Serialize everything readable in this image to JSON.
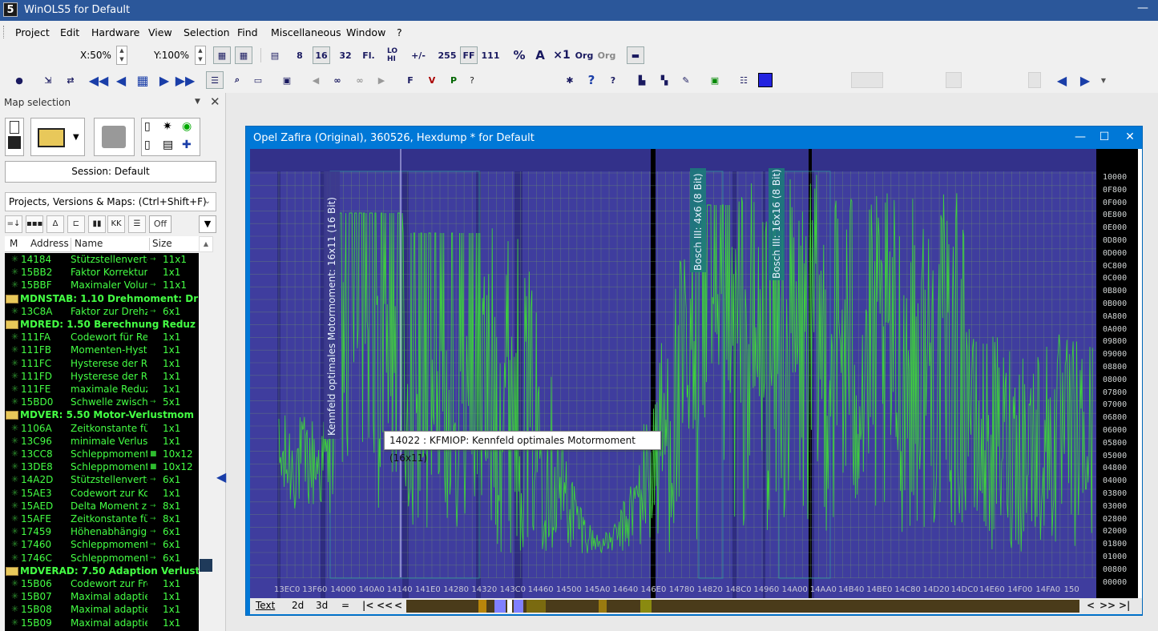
{
  "window": {
    "title": "WinOLS5 for Default",
    "app_icon": "5",
    "minimize": "—"
  },
  "menu": [
    "Project",
    "Edit",
    "Hardware",
    "View",
    "Selection",
    "Find",
    "Miscellaneous",
    "Window",
    "?"
  ],
  "toolbar1": {
    "x_zoom": "X:50%",
    "y_zoom": "Y:100%",
    "buttons": [
      "8",
      "16",
      "32",
      "Fl.",
      "LO HI",
      "+/-",
      "255",
      "FF",
      "111",
      "%",
      "A",
      "×1",
      "Org",
      "Org"
    ]
  },
  "toolbar2": {
    "help": "?"
  },
  "left_panel": {
    "title": "Map selection",
    "session": "Session: Default",
    "projects_combo": "Projects, Versions & Maps:  (Ctrl+Shift+F)",
    "off_button": "Off",
    "columns": [
      "M",
      "Address",
      "Name",
      "Size"
    ],
    "rows": [
      {
        "type": "map",
        "addr": "14184",
        "name": "Stützstellenvertei",
        "mark": "→",
        "size": "11x1"
      },
      {
        "type": "map",
        "addr": "15BB2",
        "name": "Faktor Korrektur",
        "mark": "",
        "size": "1x1"
      },
      {
        "type": "map",
        "addr": "15BBF",
        "name": "Maximaler Volume",
        "mark": "→",
        "size": "11x1"
      },
      {
        "type": "folder",
        "text": "MDNSTAB: 1.10     Drehmoment: Dr"
      },
      {
        "type": "map",
        "addr": "13C8A",
        "name": "Faktor zur Drehza",
        "mark": "→",
        "size": "6x1"
      },
      {
        "type": "folder",
        "text": "MDRED: 1.50     Berechnung Reduz"
      },
      {
        "type": "map",
        "addr": "111FA",
        "name": "Codewort für Rec",
        "mark": "",
        "size": "1x1"
      },
      {
        "type": "map",
        "addr": "111FB",
        "name": "Momenten-Hyste",
        "mark": "",
        "size": "1x1"
      },
      {
        "type": "map",
        "addr": "111FC",
        "name": "Hysterese der Re",
        "mark": "",
        "size": "1x1"
      },
      {
        "type": "map",
        "addr": "111FD",
        "name": "Hysterese der Re",
        "mark": "",
        "size": "1x1"
      },
      {
        "type": "map",
        "addr": "111FE",
        "name": "maximale Reduzie",
        "mark": "",
        "size": "1x1"
      },
      {
        "type": "map",
        "addr": "15BD0",
        "name": "Schwelle zwischer",
        "mark": "→",
        "size": "5x1"
      },
      {
        "type": "folder",
        "text": "MDVER: 5.50     Motor-Verlustmom"
      },
      {
        "type": "map",
        "addr": "1106A",
        "name": "Zeitkonstante für",
        "mark": "",
        "size": "1x1"
      },
      {
        "type": "map",
        "addr": "13C96",
        "name": "minimale Verlustn",
        "mark": "",
        "size": "1x1"
      },
      {
        "type": "map",
        "addr": "13CC8",
        "name": "Schleppmoment",
        "mark": "■",
        "size": "10x12"
      },
      {
        "type": "map",
        "addr": "13DE8",
        "name": "Schleppmoment",
        "mark": "■",
        "size": "10x12"
      },
      {
        "type": "map",
        "addr": "14A2D",
        "name": "Stützstellenvertei",
        "mark": "→",
        "size": "6x1"
      },
      {
        "type": "map",
        "addr": "15AE3",
        "name": "Codewort zur Kor",
        "mark": "",
        "size": "1x1"
      },
      {
        "type": "map",
        "addr": "15AED",
        "name": "Delta Moment zur",
        "mark": "→",
        "size": "8x1"
      },
      {
        "type": "map",
        "addr": "15AFE",
        "name": "Zeitkonstante für",
        "mark": "→",
        "size": "8x1"
      },
      {
        "type": "map",
        "addr": "17459",
        "name": "Höhenabhängige",
        "mark": "→",
        "size": "6x1"
      },
      {
        "type": "map",
        "addr": "17460",
        "name": "Schleppmoment",
        "mark": "→",
        "size": "6x1"
      },
      {
        "type": "map",
        "addr": "1746C",
        "name": "Schleppmoment",
        "mark": "→",
        "size": "6x1"
      },
      {
        "type": "folder",
        "text": "MDVERAD: 7.50     Adaption Verlust"
      },
      {
        "type": "map",
        "addr": "15B06",
        "name": "Codewort zur Frei",
        "mark": "",
        "size": "1x1"
      },
      {
        "type": "map",
        "addr": "15B07",
        "name": "Maximal adaptierl",
        "mark": "",
        "size": "1x1"
      },
      {
        "type": "map",
        "addr": "15B08",
        "name": "Maximal adaptierl",
        "mark": "",
        "size": "1x1"
      },
      {
        "type": "map",
        "addr": "15B09",
        "name": "Maximal adaptierl",
        "mark": "",
        "size": "1x1"
      }
    ]
  },
  "hexdump": {
    "title": "Opel Zafira (Original), 360526, Hexdump * for Default",
    "map_labels": [
      "Kennfeld optimales Motormoment: 16x11 (16 Bit)",
      "Bosch III: 4x6 (8 Bit)",
      "Bosch III: 16x16 (8 Bit)"
    ],
    "x_labels": [
      "13EC0",
      "13F60",
      "14000",
      "140A0",
      "14140",
      "141E0",
      "14280",
      "14320",
      "143C0",
      "14460",
      "14500",
      "145A0",
      "14640",
      "146E0",
      "14780",
      "14820",
      "148C0",
      "14960",
      "14A00",
      "14AA0",
      "14B40",
      "14BE0",
      "14C80",
      "14D20",
      "14DC0",
      "14E60",
      "14F00",
      "14FA0",
      "150"
    ],
    "y_labels": [
      "10000",
      "0F800",
      "0F000",
      "0E800",
      "0E000",
      "0D800",
      "0D000",
      "0C800",
      "0C000",
      "0B800",
      "0B000",
      "0A800",
      "0A000",
      "09800",
      "09000",
      "08800",
      "08000",
      "07800",
      "07000",
      "06800",
      "06000",
      "05800",
      "05000",
      "04800",
      "04000",
      "03800",
      "03000",
      "02800",
      "02000",
      "01800",
      "01000",
      "00800",
      "00000"
    ],
    "tooltip": "14022 : KFMIOP: Kennfeld optimales Motormoment (16x11)",
    "tabs": [
      "Text",
      "2d",
      "3d",
      "="
    ],
    "nav_left": [
      "|<",
      "<<",
      "<"
    ],
    "nav_right": [
      "<",
      ">>",
      ">|"
    ],
    "colors": {
      "background": "#3f3d9e",
      "curve": "#3ecf3e",
      "grid": "#6f8f6f",
      "frame": "#0078d7"
    }
  }
}
